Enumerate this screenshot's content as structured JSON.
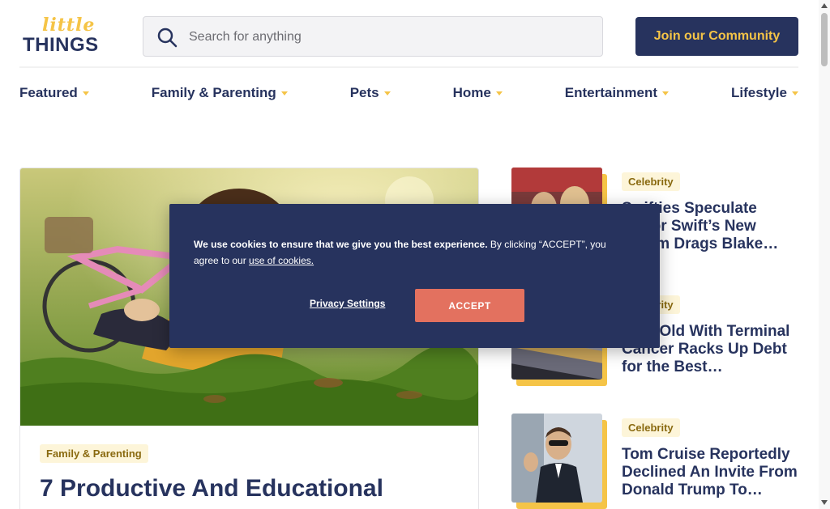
{
  "header": {
    "logo_top": "little",
    "logo_bottom": "THINGS",
    "search_placeholder": "Search for anything",
    "join_label": "Join our Community"
  },
  "nav": {
    "items": [
      {
        "label": "Featured"
      },
      {
        "label": "Family & Parenting"
      },
      {
        "label": "Pets"
      },
      {
        "label": "Home"
      },
      {
        "label": "Entertainment"
      },
      {
        "label": "Lifestyle"
      }
    ]
  },
  "feature": {
    "category": "Family & Parenting",
    "title": "7 Productive And Educational"
  },
  "side_articles": [
    {
      "category": "Celebrity",
      "title": "Swifties Speculate Taylor Swift’s New Album Drags Blake…"
    },
    {
      "category": "Celebrity",
      "title": "Year-Old With Terminal Cancer Racks Up Debt for the Best…"
    },
    {
      "category": "Celebrity",
      "title": "Tom Cruise Reportedly Declined An Invite From Donald Trump To…"
    }
  ],
  "cookie": {
    "bold_text": "We use cookies to ensure that we give you the best experience.",
    "rest_text": " By clicking “ACCEPT”, you agree to our ",
    "link_text": "use of cookies.",
    "privacy_label": "Privacy Settings",
    "accept_label": "ACCEPT"
  },
  "colors": {
    "brand_navy": "#27335e",
    "brand_yellow": "#f5c447",
    "accept": "#e3715f"
  }
}
